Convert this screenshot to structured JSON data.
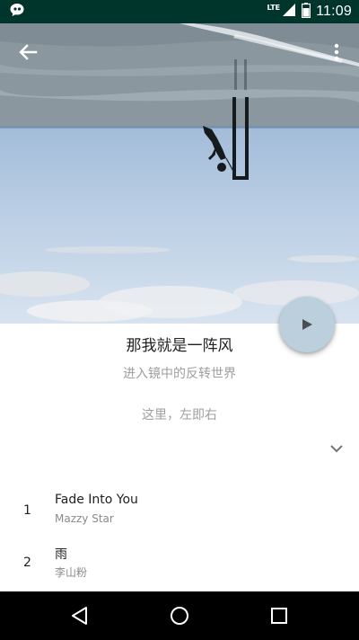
{
  "status_bar": {
    "time": "11:09",
    "network": "LTE",
    "icons": [
      "notification-icon",
      "signal-icon",
      "battery-icon"
    ]
  },
  "toolbar": {
    "back_icon": "arrow-back-icon",
    "menu_icon": "more-vertical-icon"
  },
  "album": {
    "title": "那我就是一阵风",
    "subtitle": "进入镜中的反转世界",
    "description": "这里，左即右",
    "play_icon": "play-icon",
    "expand_icon": "chevron-down-icon"
  },
  "tracks": [
    {
      "number": "1",
      "title": "Fade Into You",
      "artist": "Mazzy Star"
    },
    {
      "number": "2",
      "title": "雨",
      "artist": "李山粉"
    }
  ],
  "nav_bar": {
    "icons": [
      "back-triangle-icon",
      "home-circle-icon",
      "recents-square-icon"
    ]
  },
  "colors": {
    "status_bar": "#00352b",
    "fab": "#bccfdc",
    "secondary_text": "#9e9e9e"
  }
}
